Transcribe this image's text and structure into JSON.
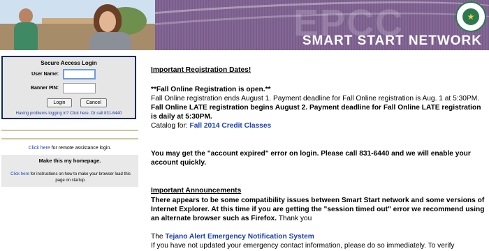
{
  "header": {
    "title": "SMART START NETWORK",
    "watermark": "EPCC",
    "seal_text": "EL PASO COMMUNITY COLLEGE"
  },
  "login": {
    "title": "Secure Access Login",
    "user_label": "User Name:",
    "pin_label": "Banner PIN:",
    "user_value": "",
    "pin_value": "",
    "login_button": "Login",
    "cancel_button": "Cancel",
    "help_text": "Having problems logging in? Click here. Or call 831-6440"
  },
  "sidebar": {
    "remote_link": "Click here",
    "remote_text": " for remote assistance login.",
    "homepage_title": "Make this my homepage.",
    "homepage_link": "Click here",
    "homepage_text": " for instructions on how to make your browser load this page on startup."
  },
  "main": {
    "reg_heading": "Important Registration Dates!",
    "fall_open": "**Fall Online Registration is open.**",
    "fall_ends": "Fall Online registration ends August 1. Payment deadline for Fall Online registration is Aug. 1 at 5:30PM.",
    "late_reg": "Fall Online LATE registration begins August 2. Payment deadline for Fall Online LATE registration is daily at 5:30PM.",
    "catalog_prefix": "Catalog for: ",
    "catalog_link": "Fall 2014 Credit Classes",
    "expired_notice": "You may get the \"account expired\" error on login. Please call 831-6440 and we will enable your account quickly.",
    "ann_heading": "Important Announcements",
    "ann_bold": "There appears to be some compatibility issues between Smart Start network and some versions of Internet Explorer. At this time if you are getting the \"session timed out\" error we recommend using an alternate browser such as Firefox.",
    "ann_thanks": " Thank you",
    "tejano_prefix": "The ",
    "tejano_link": "Tejano Alert Emergency Notification System",
    "tejano_text": "If you have not updated your emergency contact information, please do so immediately. To verify"
  }
}
